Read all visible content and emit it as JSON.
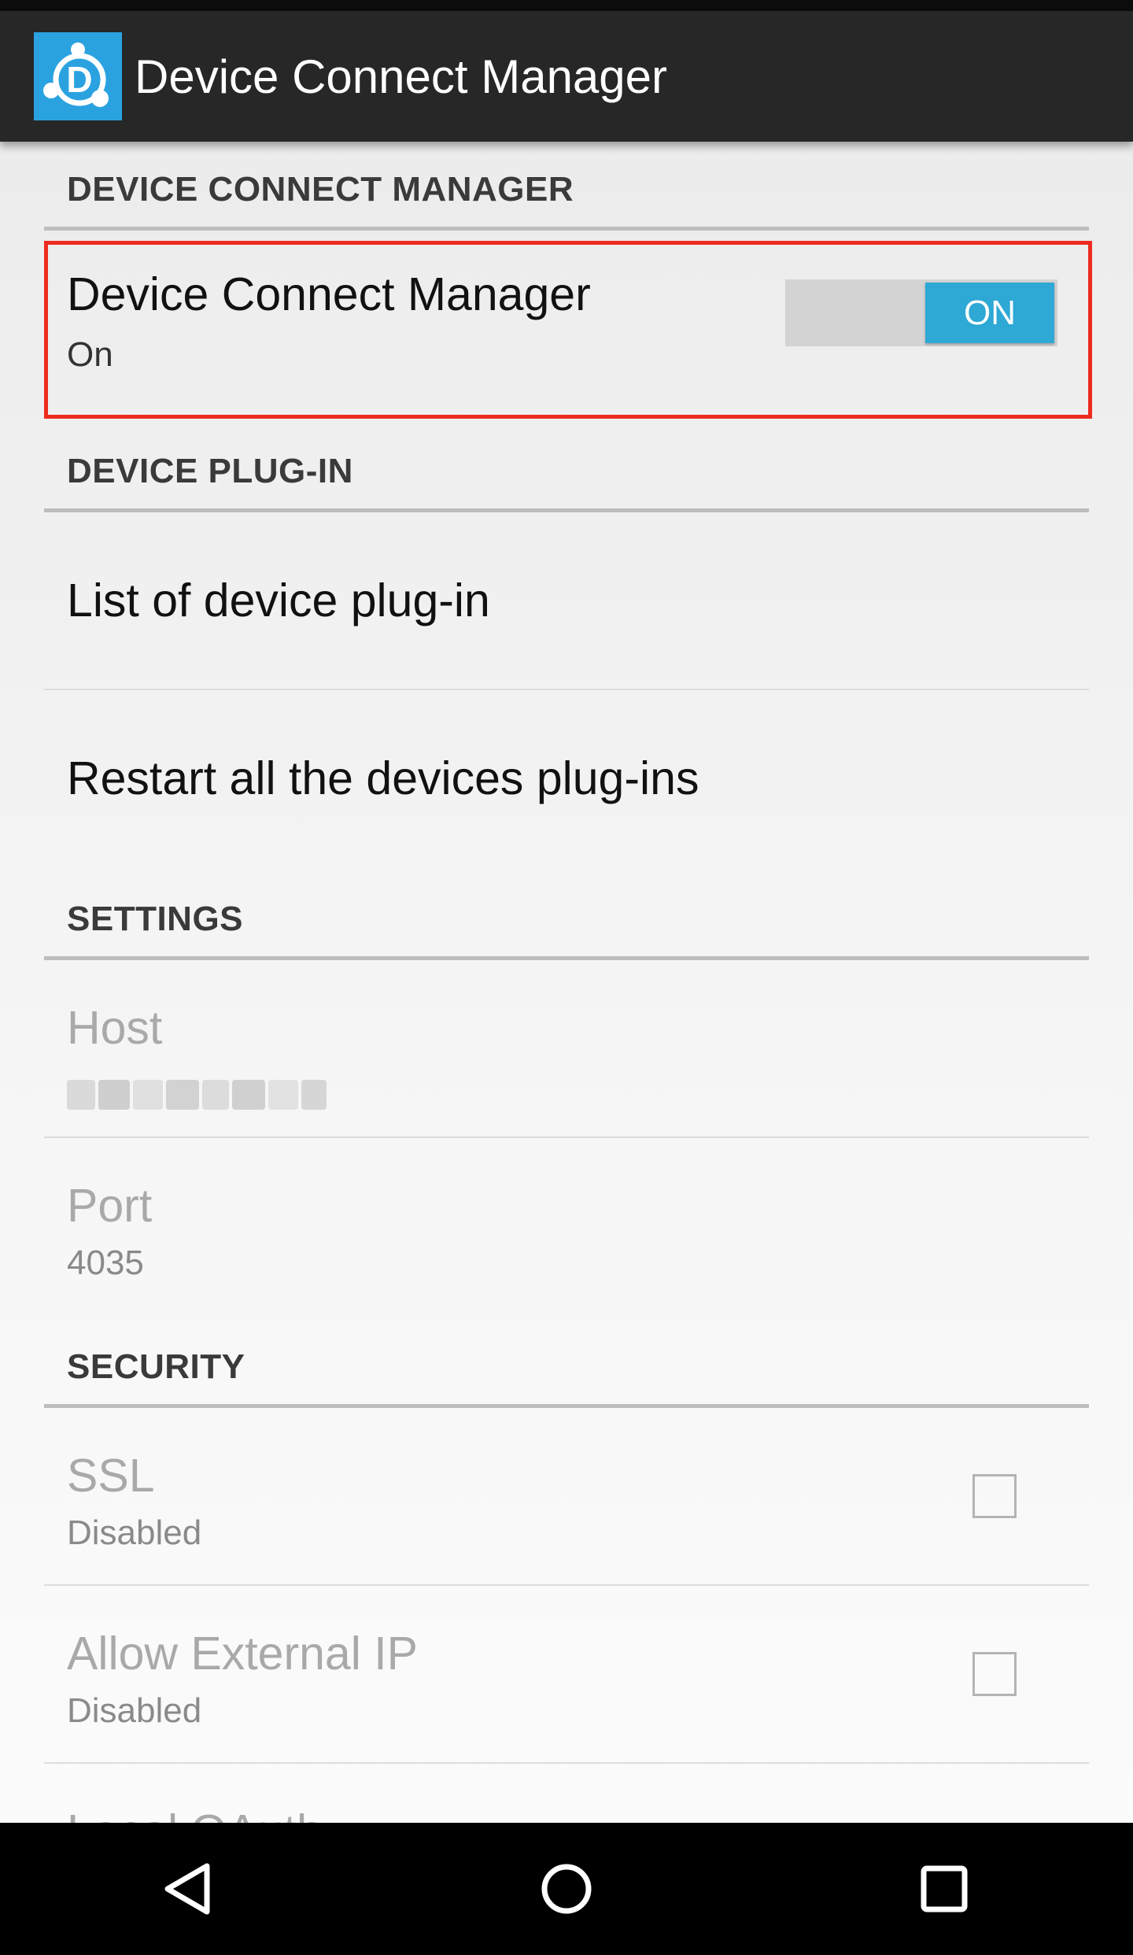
{
  "app": {
    "title": "Device Connect Manager",
    "icon": "device-connect-logo-icon",
    "accent_color": "#2ba2e0"
  },
  "sections": {
    "manager": {
      "header": "DEVICE CONNECT MANAGER",
      "toggle_pref": {
        "title": "Device Connect Manager",
        "summary": "On",
        "switch_label": "ON",
        "checked": true
      }
    },
    "plugin": {
      "header": "DEVICE PLUG-IN",
      "items": [
        {
          "title": "List of device plug-in"
        },
        {
          "title": "Restart all the devices plug-ins"
        }
      ]
    },
    "settings": {
      "header": "SETTINGS",
      "host": {
        "title": "Host"
      },
      "port": {
        "title": "Port",
        "summary": "4035"
      }
    },
    "security": {
      "header": "SECURITY",
      "ssl": {
        "title": "SSL",
        "summary": "Disabled",
        "checked": false
      },
      "external_ip": {
        "title": "Allow External IP",
        "summary": "Disabled",
        "checked": false
      },
      "local_oauth": {
        "title": "Local OAuth",
        "checked": true
      }
    }
  },
  "nav": {
    "back": "back-icon",
    "home": "home-icon",
    "recents": "recents-icon"
  },
  "colors": {
    "highlight_border": "#ee2b1f",
    "switch_on": "#2ea8d5"
  }
}
